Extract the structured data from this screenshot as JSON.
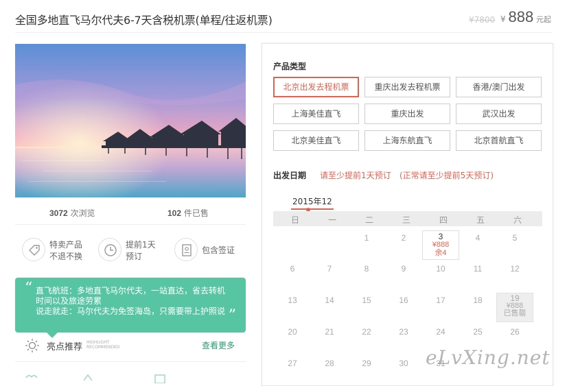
{
  "header": {
    "title": "全国多地直飞马尔代夫6-7天含税机票(单程/往返机票)",
    "old_price": "¥7800",
    "currency": "¥",
    "price": "888",
    "price_unit": "元起"
  },
  "stats": {
    "views_num": "3072",
    "views_label": "次浏览",
    "sold_num": "102",
    "sold_label": "件已售"
  },
  "features": [
    {
      "icon": "tag-icon",
      "line1": "特卖产品",
      "line2": "不退不换"
    },
    {
      "icon": "clock-icon",
      "line1": "提前1天",
      "line2": "预订"
    },
    {
      "icon": "document-icon",
      "line1": "包含签证",
      "line2": ""
    }
  ],
  "highlight_box": {
    "line1": "直飞航班：多地直飞马尔代夫，一站直达，省去转机",
    "line2": "时间以及旅途劳累",
    "line3": "说走就走：马尔代夫为免签海岛，只需要带上护照说"
  },
  "highlights": {
    "label": "亮点推荐",
    "en1": "HIGHLIGHT",
    "en2": "RECOMMENDED",
    "more": "查看更多"
  },
  "panel": {
    "product_type_title": "产品类型",
    "options": [
      "北京出发去程机票",
      "重庆出发去程机票",
      "香港/澳门出发",
      "上海美佳直飞",
      "重庆出发",
      "武汉出发",
      "北京美佳直飞",
      "上海东航直飞",
      "北京首航直飞"
    ],
    "selected_option": 0,
    "date_title": "出发日期",
    "note1": "请至少提前1天预订",
    "note2": "(正常请至少提前5天预订)",
    "month": "2015年12",
    "weekdays": [
      "日",
      "一",
      "二",
      "三",
      "四",
      "五",
      "六"
    ],
    "rows": [
      [
        "",
        "",
        "1",
        "2",
        "3",
        "4",
        "5"
      ],
      [
        "6",
        "7",
        "8",
        "9",
        "10",
        "11",
        "12"
      ],
      [
        "13",
        "14",
        "15",
        "16",
        "17",
        "18",
        "19"
      ],
      [
        "20",
        "21",
        "22",
        "23",
        "24",
        "25",
        "26"
      ],
      [
        "27",
        "28",
        "29",
        "30",
        "31",
        "",
        ""
      ]
    ],
    "available": {
      "day": "3",
      "price": "¥888",
      "remain": "余4"
    },
    "soldout": {
      "day": "19",
      "price": "¥888",
      "status": "已售罄"
    }
  },
  "watermark": "eLvXing.net",
  "colors": {
    "accent_red": "#e3624f",
    "green": "#58c5a2",
    "link_green": "#2a9b75"
  }
}
